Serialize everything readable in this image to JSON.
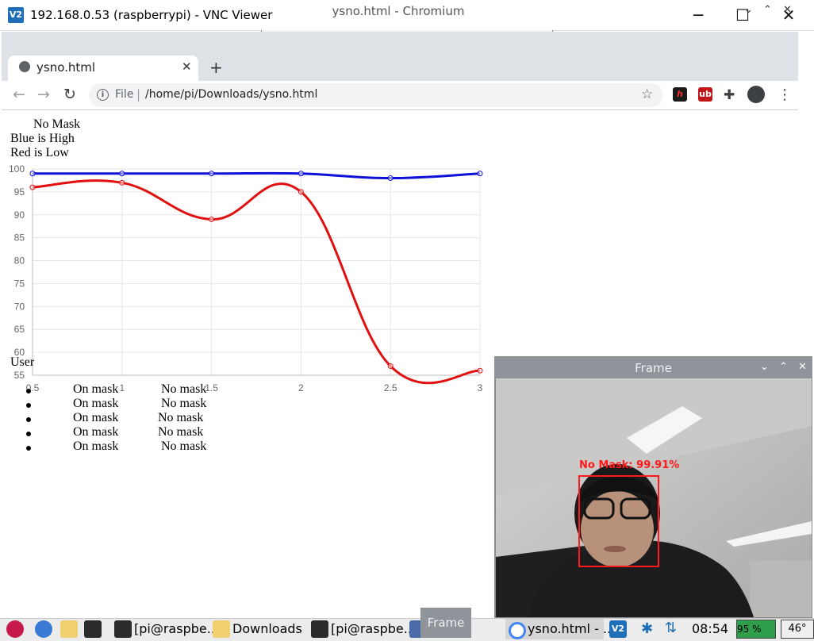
{
  "vnc": {
    "title": "192.168.0.53 (raspberrypi) - VNC Viewer",
    "logo_text": "V2",
    "minimize": "─",
    "maximize": "☐",
    "close": "✕"
  },
  "browser": {
    "window_title": "ysno.html - Chromium",
    "tab_title": "ysno.html",
    "tab_close": "✕",
    "new_tab": "+",
    "back": "←",
    "forward": "→",
    "reload": "↻",
    "info": "i",
    "file_label": "File",
    "separator": "|",
    "url": "/home/pi/Downloads/ysno.html",
    "star": "☆",
    "menu": "⋮",
    "win_down": "⌄",
    "win_up": "⌃",
    "win_close": "✕"
  },
  "page": {
    "heading": "No Mask",
    "legend_high": "Blue is High",
    "legend_low": "Red is Low",
    "user_label": "User",
    "list": [
      {
        "a": "On mask",
        "b": "No mask"
      },
      {
        "a": "On mask",
        "b": "No mask"
      },
      {
        "a": "On mask",
        "b": "No mask"
      },
      {
        "a": "On mask",
        "b": "No mask"
      },
      {
        "a": "On mask",
        "b": "No mask"
      }
    ]
  },
  "chart_data": {
    "type": "line",
    "x": [
      0.5,
      1,
      1.5,
      2,
      2.5,
      3
    ],
    "xticks": [
      "0.5",
      "1",
      "1.5",
      "2",
      "2.5",
      "3"
    ],
    "ylim": [
      55,
      100
    ],
    "yticks": [
      "100",
      "95",
      "90",
      "85",
      "80",
      "75",
      "70",
      "65",
      "60",
      "55"
    ],
    "series": [
      {
        "color": "#1010d8",
        "values": [
          99,
          99,
          99,
          99,
          98,
          99
        ]
      },
      {
        "color": "#e01010",
        "values": [
          96,
          97,
          89,
          95,
          57,
          56
        ]
      }
    ],
    "grid": true
  },
  "frame": {
    "title": "Frame",
    "detection_label": "No Mask: 99.91%"
  },
  "taskbar": {
    "items": [
      "[pi@raspbe...",
      "Downloads",
      "[pi@raspbe...",
      "ysno.html - ..."
    ],
    "frame_item": "Frame",
    "clock": "08:54",
    "cpu": "95 %",
    "temp": "46°"
  }
}
